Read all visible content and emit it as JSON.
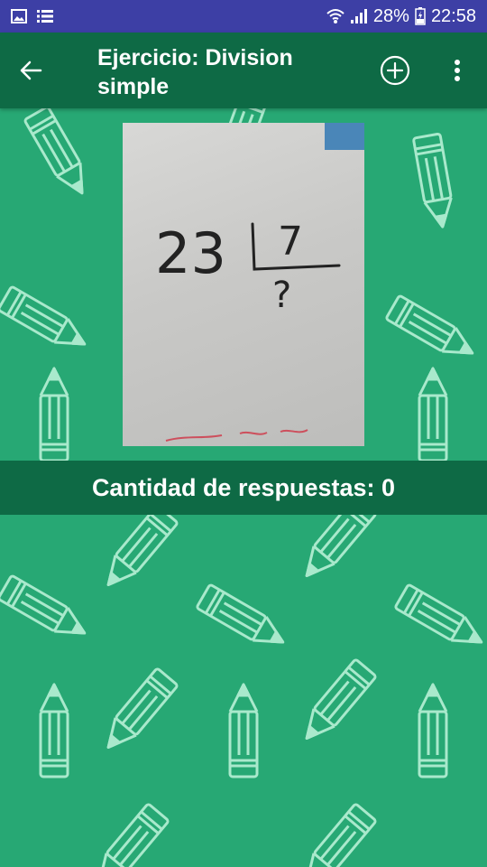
{
  "status_bar": {
    "battery_percent": "28%",
    "time": "22:58",
    "icons": [
      "image-icon",
      "list-icon",
      "wifi-icon",
      "signal-icon",
      "battery-icon"
    ]
  },
  "app_bar": {
    "title": "Ejercicio: Division simple",
    "icons": [
      "back-arrow-icon",
      "add-circle-icon",
      "more-vert-icon"
    ]
  },
  "exercise": {
    "handwritten_dividend": "23",
    "handwritten_divisor": "7",
    "handwritten_question": "?"
  },
  "answers": {
    "label": "Cantidad de respuestas: 0"
  },
  "colors": {
    "status_bar": "#3d3fa5",
    "app_bar": "#0e6a45",
    "background": "#27a874",
    "counter_bar": "#0e6a45"
  }
}
